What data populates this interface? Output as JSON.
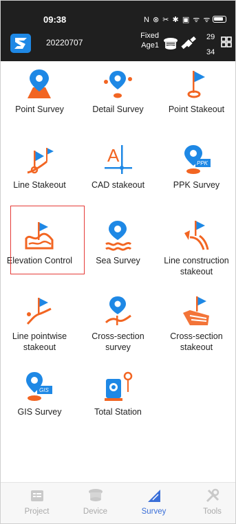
{
  "status_bar": {
    "time": "09:38",
    "icons_text": "N ⊗ ✂ ✱ ▣ ᯤ ᯤ"
  },
  "header": {
    "project_id": "20220707",
    "fix_label": "Fixed",
    "age_label": "Age1",
    "sat_count_top": "29",
    "sat_count_bottom": "34"
  },
  "tiles": [
    {
      "label": "Point Survey",
      "icon": "point-survey-icon"
    },
    {
      "label": "Detail Survey",
      "icon": "detail-survey-icon"
    },
    {
      "label": "Point Stakeout",
      "icon": "point-stakeout-icon"
    },
    {
      "label": "Line Stakeout",
      "icon": "line-stakeout-icon"
    },
    {
      "label": "CAD stakeout",
      "icon": "cad-stakeout-icon"
    },
    {
      "label": "PPK Survey",
      "icon": "ppk-survey-icon",
      "badge": "PPK"
    },
    {
      "label": "Elevation Control",
      "icon": "elevation-control-icon",
      "selected": true
    },
    {
      "label": "Sea Survey",
      "icon": "sea-survey-icon"
    },
    {
      "label": "Line construction stakeout",
      "icon": "line-construction-stakeout-icon"
    },
    {
      "label": "Line pointwise stakeout",
      "icon": "line-pointwise-stakeout-icon"
    },
    {
      "label": "Cross-section survey",
      "icon": "cross-section-survey-icon"
    },
    {
      "label": "Cross-section stakeout",
      "icon": "cross-section-stakeout-icon"
    },
    {
      "label": "GIS Survey",
      "icon": "gis-survey-icon",
      "badge": "GIS"
    },
    {
      "label": "Total Station",
      "icon": "total-station-icon"
    }
  ],
  "bottom_nav": [
    {
      "label": "Project",
      "icon": "project-icon",
      "active": false
    },
    {
      "label": "Device",
      "icon": "device-icon",
      "active": false
    },
    {
      "label": "Survey",
      "icon": "survey-icon",
      "active": true
    },
    {
      "label": "Tools",
      "icon": "tools-icon",
      "active": false
    }
  ],
  "colors": {
    "accent_orange": "#f26522",
    "accent_blue": "#1e88e5",
    "selection_red": "#e53935",
    "nav_active": "#3a6fd8",
    "nav_inactive": "#a9a9a9",
    "header_bg": "#1f1f1f"
  }
}
